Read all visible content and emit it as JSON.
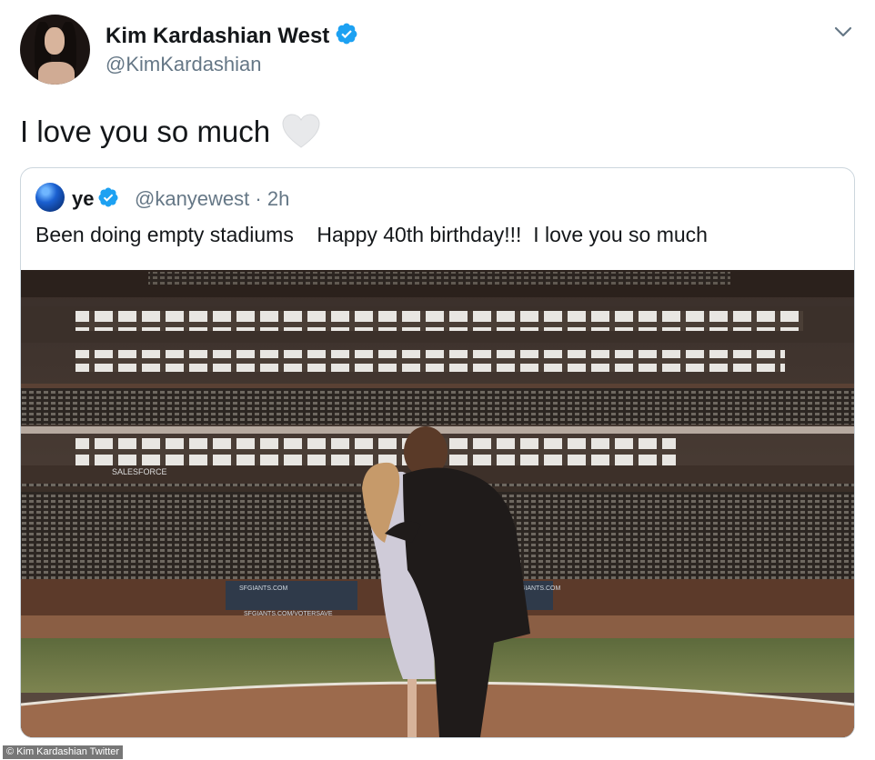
{
  "tweet": {
    "author_name": "Kim Kardashian West",
    "author_handle": "@KimKardashian",
    "text": "I love you so much"
  },
  "quoted_tweet": {
    "author_name": "ye",
    "author_handle": "@kanyewest",
    "time": "· 2h",
    "text": "Been doing empty stadiums    Happy 40th birthday!!!  I love you so much"
  },
  "photo": {
    "signs": [
      "SALESFORCE",
      "SFGIANTS.COM",
      "SFGIANTS.COM",
      "SFGIANTS.COM/VOTERSAVE"
    ]
  },
  "icons": {
    "verified": "verified-badge-icon",
    "heart": "white-heart-emoji",
    "menu": "chevron-down-icon"
  },
  "colors": {
    "verified_blue": "#1da1f2",
    "handle_gray": "#657786",
    "border": "#ccd6dd"
  },
  "credit": "© Kim Kardashian Twitter"
}
